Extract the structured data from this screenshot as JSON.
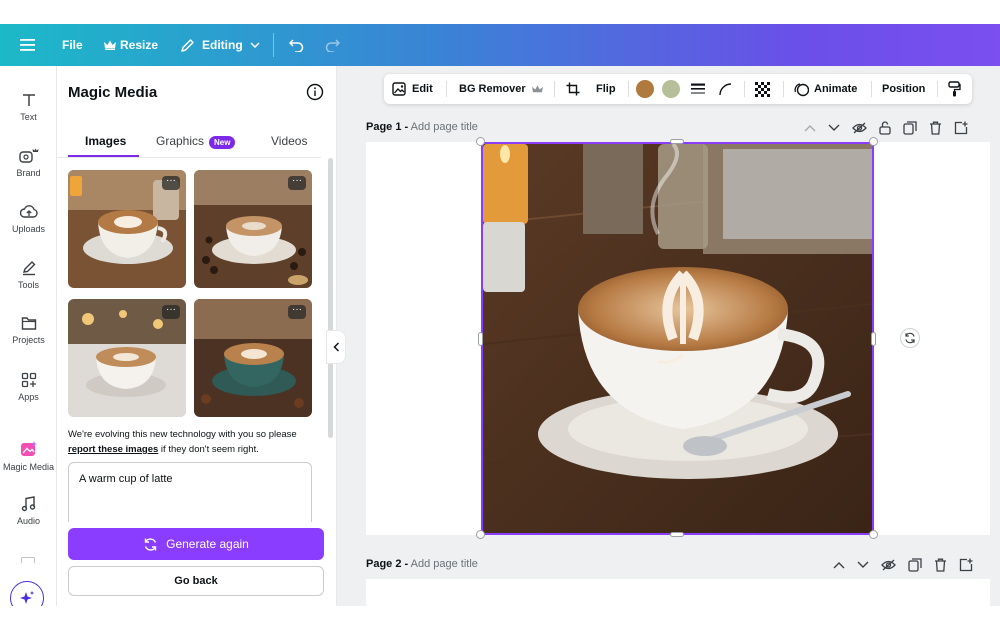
{
  "topbar": {
    "file_label": "File",
    "resize_label": "Resize",
    "editing_label": "Editing"
  },
  "rail": {
    "items": [
      {
        "label": "Text",
        "icon": "text-icon"
      },
      {
        "label": "Brand",
        "icon": "brand-icon"
      },
      {
        "label": "Uploads",
        "icon": "upload-icon"
      },
      {
        "label": "Tools",
        "icon": "pencil-icon"
      },
      {
        "label": "Projects",
        "icon": "folder-icon"
      },
      {
        "label": "Apps",
        "icon": "apps-icon"
      },
      {
        "label": "Magic Media",
        "icon": "magic-media-icon"
      },
      {
        "label": "Audio",
        "icon": "music-icon"
      }
    ]
  },
  "panel": {
    "title": "Magic Media",
    "tabs": [
      {
        "label": "Images",
        "active": true
      },
      {
        "label": "Graphics",
        "active": false
      },
      {
        "label": "Videos",
        "active": false
      }
    ],
    "new_badge": "New",
    "notice_text": "We're evolving this new technology with you so please",
    "notice_link": "report these images",
    "notice_suffix": " if they don't seem right.",
    "prompt": "A warm cup of latte",
    "generate_label": "Generate again",
    "back_label": "Go back"
  },
  "context_toolbar": {
    "edit_label": "Edit",
    "bg_remover_label": "BG Remover",
    "flip_label": "Flip",
    "animate_label": "Animate",
    "position_label": "Position",
    "swatch_colors": [
      "#b07a3f",
      "#b6bf9a"
    ]
  },
  "pages": [
    {
      "label": "Page 1 -",
      "title_placeholder": "Add page title"
    },
    {
      "label": "Page 2 -",
      "title_placeholder": "Add page title"
    }
  ],
  "colors": {
    "accent": "#8b3dff",
    "topbar_start": "#1cb9c8",
    "topbar_end": "#7b4ff0"
  }
}
